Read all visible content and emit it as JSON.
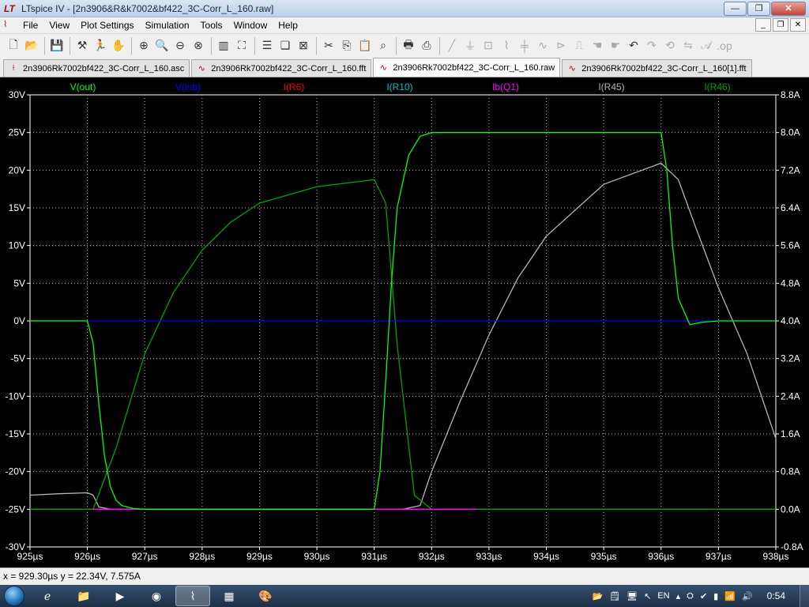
{
  "window": {
    "app_logo": "LT",
    "title": "LTspice IV - [2n3906&R&k7002&bf422_3C-Corr_L_160.raw]",
    "controls": {
      "minimize": "—",
      "maximize": "❐",
      "close": "✕"
    }
  },
  "menu": {
    "items": [
      "File",
      "View",
      "Plot Settings",
      "Simulation",
      "Tools",
      "Window",
      "Help"
    ],
    "mdi_controls": {
      "minimize": "_",
      "restore": "❐",
      "close": "✕"
    }
  },
  "tabs": [
    {
      "label": "2n3906Rk7002bf422_3C-Corr_L_160.asc",
      "icon": "schematic-icon",
      "active": false
    },
    {
      "label": "2n3906Rk7002bf422_3C-Corr_L_160.fft",
      "icon": "waveform-icon",
      "active": false
    },
    {
      "label": "2n3906Rk7002bf422_3C-Corr_L_160.raw",
      "icon": "waveform-icon",
      "active": true
    },
    {
      "label": "2n3906Rk7002bf422_3C-Corr_L_160[1].fft",
      "icon": "waveform-icon",
      "active": false
    }
  ],
  "status": {
    "text": "x = 929.30µs   y = 22.34V, 7.575A"
  },
  "taskbar": {
    "language": "EN",
    "clock": "0:54"
  },
  "colors": {
    "plot_bg": "#000000",
    "axis": "#ffffff",
    "grid": "#b4b4b4",
    "vout": "#00ff00",
    "vinb": "#0000ff",
    "ir6": "#ff0000",
    "ir10": "#00c0c0",
    "ibq1": "#ff00ff",
    "ir45": "#b4b4b4",
    "ir46": "#00a000"
  },
  "chart_data": {
    "type": "line",
    "xlabel_units": "µs",
    "xlim": [
      925,
      938
    ],
    "ylim_left": [
      -30,
      30
    ],
    "ylim_right": [
      -0.8,
      8.8
    ],
    "grid": true,
    "x_ticks": [
      "925µs",
      "926µs",
      "927µs",
      "928µs",
      "929µs",
      "930µs",
      "931µs",
      "932µs",
      "933µs",
      "934µs",
      "935µs",
      "936µs",
      "937µs",
      "938µs"
    ],
    "y_left_ticks": [
      "30V",
      "25V",
      "20V",
      "15V",
      "10V",
      "5V",
      "0V",
      "-5V",
      "-10V",
      "-15V",
      "-20V",
      "-25V",
      "-30V"
    ],
    "y_right_ticks": [
      "8.8A",
      "8.0A",
      "7.2A",
      "6.4A",
      "5.6A",
      "4.8A",
      "4.0A",
      "3.2A",
      "2.4A",
      "1.6A",
      "0.8A",
      "0.0A",
      "-0.8A"
    ],
    "series": [
      {
        "name": "V(out)",
        "color_key": "vout",
        "axis": "left",
        "x": [
          925,
          926.0,
          926.1,
          926.2,
          926.3,
          926.4,
          926.5,
          926.6,
          926.8,
          927.0,
          931.0,
          931.1,
          931.2,
          931.3,
          931.4,
          931.6,
          931.8,
          932.0,
          936.0,
          936.1,
          936.2,
          936.3,
          936.5,
          936.7,
          937.0,
          938.0
        ],
        "y": [
          0,
          0,
          -3,
          -11,
          -18,
          -22,
          -23.8,
          -24.5,
          -24.9,
          -25,
          -25,
          -20,
          -8,
          5,
          15,
          22,
          24.5,
          25,
          25,
          20,
          10,
          3,
          -0.5,
          -0.2,
          0,
          0
        ]
      },
      {
        "name": "V(inb)",
        "color_key": "vinb",
        "axis": "left",
        "x": [
          925,
          938
        ],
        "y": [
          0,
          0
        ]
      },
      {
        "name": "I(R6)",
        "color_key": "ir6",
        "axis": "right",
        "x": [
          925,
          938
        ],
        "y": [
          0,
          0
        ]
      },
      {
        "name": "I(R10)",
        "color_key": "ir10",
        "axis": "right",
        "x": [
          925,
          938
        ],
        "y": [
          0,
          0
        ]
      },
      {
        "name": "Ib(Q1)",
        "color_key": "ibq1",
        "axis": "right",
        "x": [
          926.1,
          926.9,
          931.6,
          932.8
        ],
        "y": [
          0,
          0,
          0,
          0
        ]
      },
      {
        "name": "I(R45)",
        "color_key": "ir45",
        "axis": "right",
        "x": [
          925,
          925.5,
          926.0,
          926.1,
          926.2,
          926.4,
          927.0,
          927.5,
          928.0,
          928.5,
          929.0,
          930.0,
          931.0,
          931.5,
          931.8,
          932.0,
          932.5,
          933.0,
          933.5,
          934.0,
          935.0,
          936.0,
          936.3,
          936.6,
          937.0,
          937.5,
          938.0
        ],
        "y": [
          0.3,
          0.33,
          0.35,
          0.3,
          0.05,
          0.0,
          0.0,
          0.0,
          0.0,
          0.0,
          0.0,
          0.0,
          0.0,
          0.0,
          0.08,
          0.8,
          2.3,
          3.7,
          4.9,
          5.8,
          6.9,
          7.35,
          7.0,
          6.0,
          4.7,
          3.3,
          1.5
        ]
      },
      {
        "name": "I(R46)",
        "color_key": "ir46",
        "axis": "right",
        "x": [
          925,
          926.0,
          926.1,
          926.5,
          927.0,
          927.5,
          928.0,
          928.5,
          929.0,
          930.0,
          931.0,
          931.2,
          931.4,
          931.7,
          932.0,
          938.0
        ],
        "y": [
          0,
          0,
          0,
          1.3,
          3.3,
          4.6,
          5.5,
          6.1,
          6.5,
          6.85,
          7.0,
          6.5,
          3.5,
          0.3,
          0.0,
          0.0
        ]
      }
    ]
  }
}
